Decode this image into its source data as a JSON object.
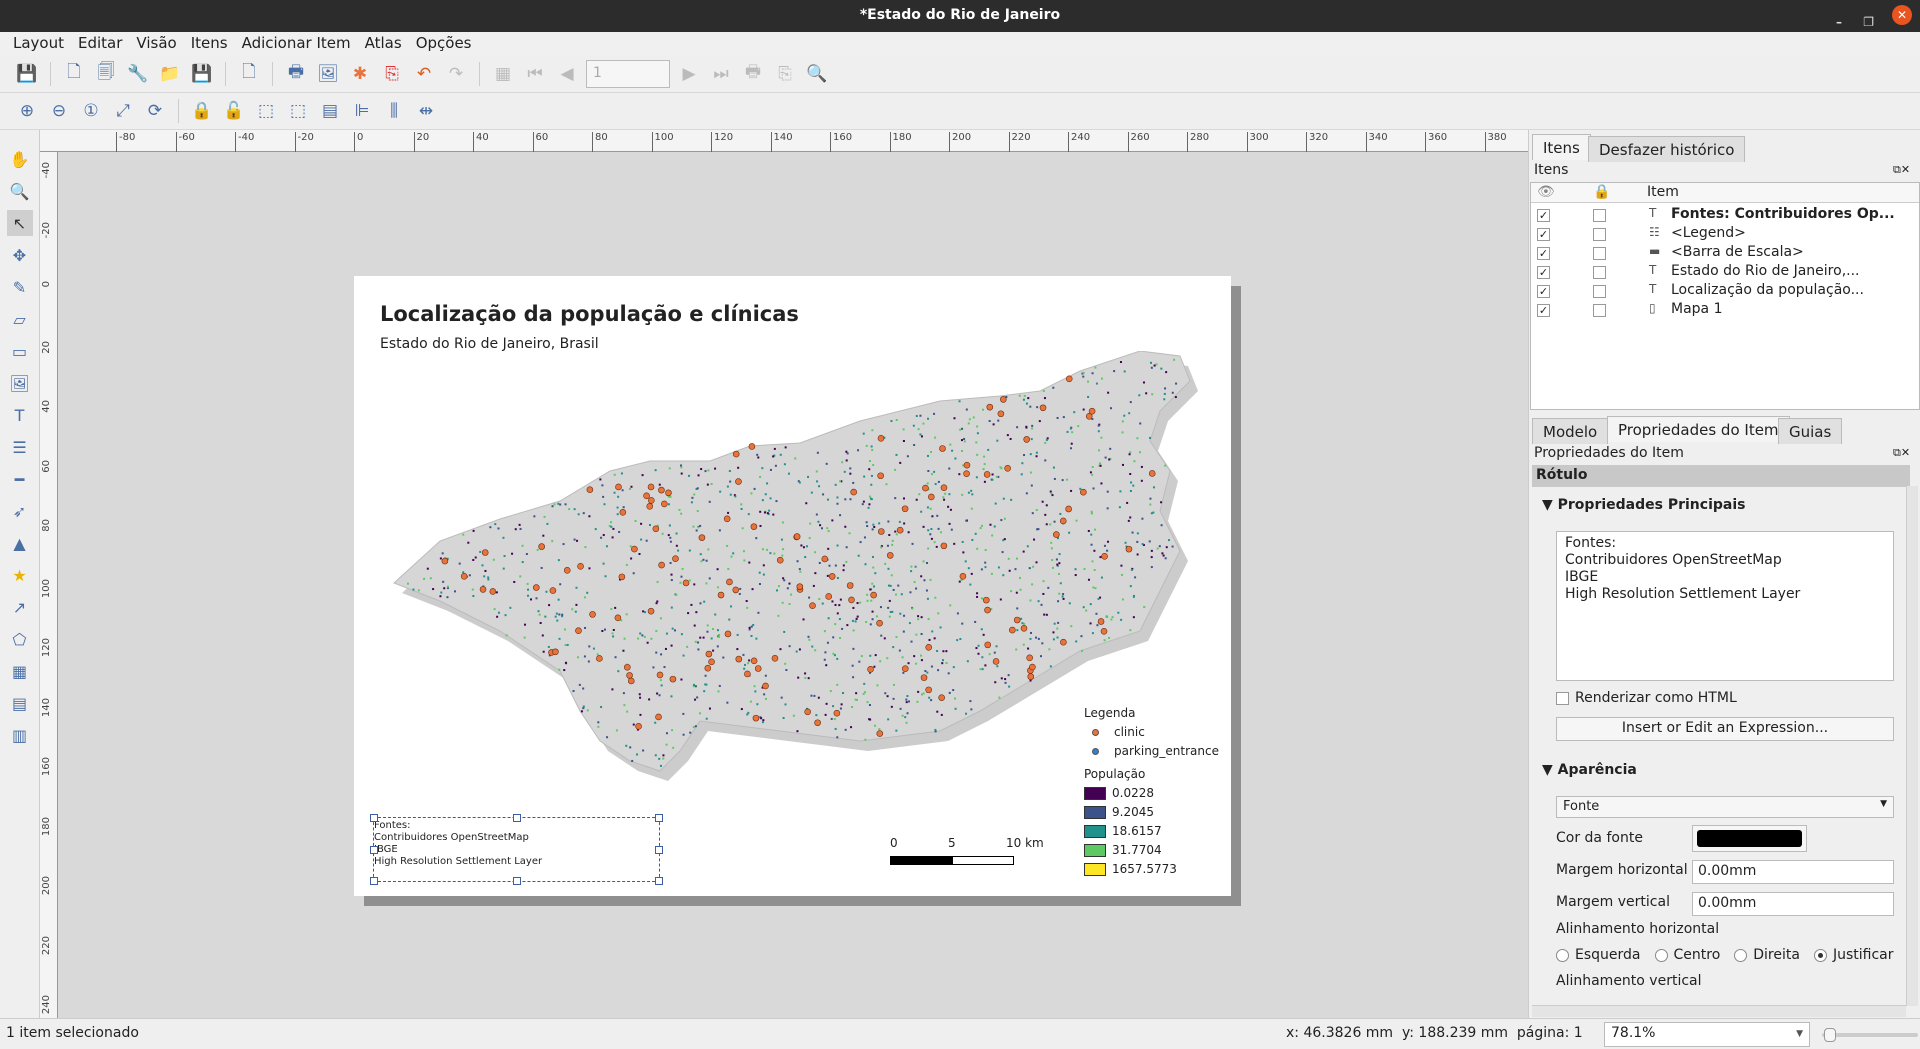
{
  "window": {
    "title": "*Estado do Rio de Janeiro"
  },
  "menu": [
    "Layout",
    "Editar",
    "Visão",
    "Itens",
    "Adicionar Item",
    "Atlas",
    "Opções"
  ],
  "toolbar": {
    "page_value": "1"
  },
  "ruler": {
    "h_ticks": [
      "-80",
      "-60",
      "-40",
      "-20",
      "0",
      "20",
      "40",
      "60",
      "80",
      "100",
      "120",
      "140",
      "160",
      "180",
      "200",
      "220",
      "240",
      "260",
      "280",
      "300",
      "320",
      "340",
      "360",
      "380"
    ],
    "v_ticks": [
      "-40",
      "-20",
      "0",
      "20",
      "40",
      "60",
      "80",
      "100",
      "120",
      "140",
      "160",
      "180",
      "200",
      "220",
      "240"
    ]
  },
  "layout": {
    "title": "Localização da população e clínicas",
    "subtitle": "Estado do Rio de Janeiro, Brasil",
    "legend": {
      "title": "Legenda",
      "points": [
        {
          "label": "clinic",
          "color": "#e8743b"
        },
        {
          "label": "parking_entrance",
          "color": "#2f7fd6"
        }
      ],
      "pop_title": "População",
      "classes": [
        {
          "label": "0.0228",
          "color": "#440154"
        },
        {
          "label": "9.2045",
          "color": "#3b528b"
        },
        {
          "label": "18.6157",
          "color": "#21918c"
        },
        {
          "label": "31.7704",
          "color": "#5ec962"
        },
        {
          "label": "1657.5773",
          "color": "#fde725"
        }
      ]
    },
    "scalebar": {
      "labels": [
        "0",
        "5",
        "10 km"
      ]
    },
    "sources": "Fontes:\nContribuidores OpenStreetMap\nIBGE\nHigh Resolution Settlement Layer"
  },
  "panel": {
    "tabs": [
      "Itens",
      "Desfazer histórico"
    ],
    "items_title": "Itens",
    "col_item": "Item",
    "items": [
      {
        "label": "Fontes: Contribuidores Op...",
        "icon": "text",
        "bold": true
      },
      {
        "label": "<Legend>",
        "icon": "legend"
      },
      {
        "label": "<Barra de Escala>",
        "icon": "scalebar"
      },
      {
        "label": "Estado do Rio de Janeiro,...",
        "icon": "text"
      },
      {
        "label": "Localização da população...",
        "icon": "text"
      },
      {
        "label": "Mapa 1",
        "icon": "map"
      }
    ],
    "tabs2": [
      "Modelo",
      "Propriedades do Item",
      "Guias"
    ],
    "props_title": "Propriedades do Item",
    "item_type": "Rótulo",
    "main_props": "Propriedades Principais",
    "label_text": "Fontes:\nContribuidores OpenStreetMap\nIBGE\nHigh Resolution Settlement Layer",
    "render_html": "Renderizar como HTML",
    "expr_button": "Insert or Edit an Expression...",
    "appearance": "Aparência",
    "font_button": "Fonte",
    "font_color_label": "Cor da fonte",
    "font_color": "#000000",
    "hmargin_label": "Margem horizontal",
    "hmargin": "0.00mm",
    "vmargin_label": "Margem vertical",
    "vmargin": "0.00mm",
    "halign_label": "Alinhamento horizontal",
    "halign_options": [
      "Esquerda",
      "Centro",
      "Direita",
      "Justificar"
    ],
    "halign_selected": "Justificar",
    "valign_label": "Alinhamento vertical"
  },
  "status": {
    "selection": "1 item selecionado",
    "coords": "x: 46.3826 mm  y: 188.239 mm  página: 1",
    "zoom": "78.1%"
  }
}
